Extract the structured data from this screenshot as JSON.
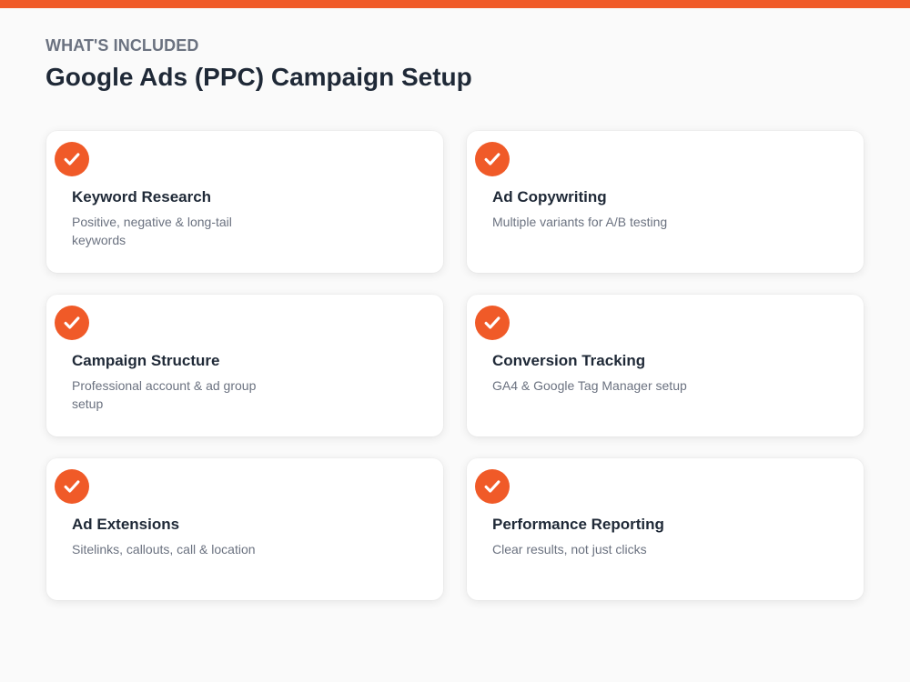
{
  "theme": {
    "accent": "#f05a28",
    "title_color": "#1f2937",
    "muted_color": "#6b7280",
    "background": "#fafafa",
    "card_background": "#ffffff"
  },
  "header": {
    "eyebrow": "WHAT'S INCLUDED",
    "title": "Google Ads (PPC) Campaign Setup"
  },
  "features": [
    {
      "icon": "check-icon",
      "title": "Keyword Research",
      "description": "Positive, negative & long-tail keywords"
    },
    {
      "icon": "check-icon",
      "title": "Ad Copywriting",
      "description": "Multiple variants for A/B testing"
    },
    {
      "icon": "check-icon",
      "title": "Campaign Structure",
      "description": "Professional account & ad group setup"
    },
    {
      "icon": "check-icon",
      "title": "Conversion Tracking",
      "description": "GA4 & Google Tag Manager setup"
    },
    {
      "icon": "check-icon",
      "title": "Ad Extensions",
      "description": "Sitelinks, callouts, call & location"
    },
    {
      "icon": "check-icon",
      "title": "Performance Reporting",
      "description": "Clear results, not just clicks"
    }
  ]
}
